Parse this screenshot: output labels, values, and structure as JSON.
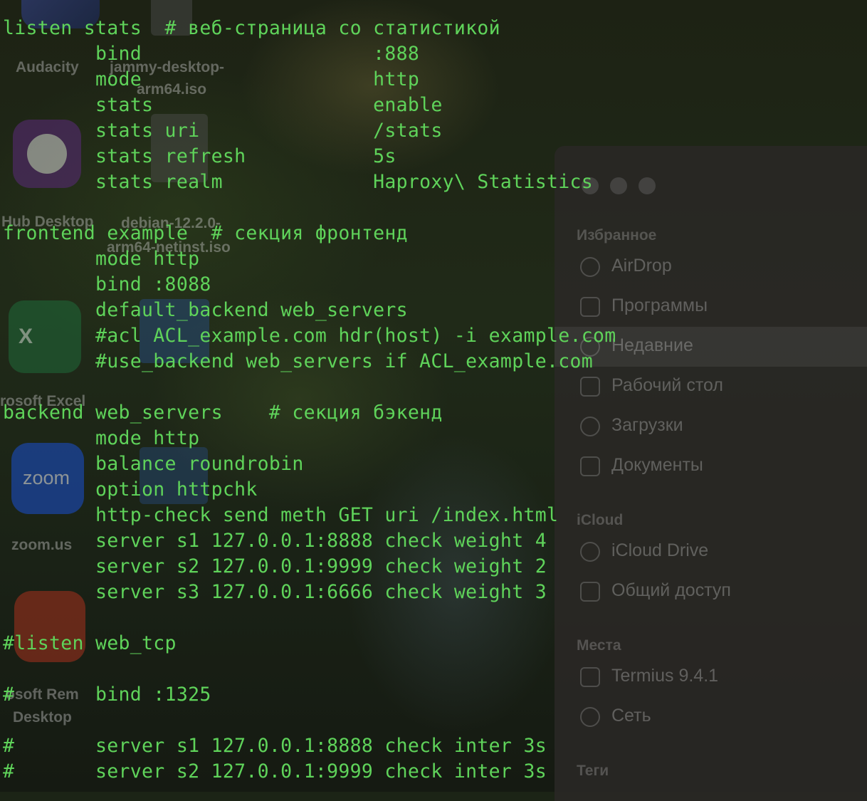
{
  "desktop": {
    "icons": [
      {
        "name": "audacity",
        "label_lines": [
          "Audacity"
        ]
      },
      {
        "name": "jammy-iso",
        "label_lines": [
          "jammy-desktop-",
          "arm64.iso"
        ]
      },
      {
        "name": "github-desktop",
        "label_lines": [
          "Hub Desktop"
        ]
      },
      {
        "name": "debian-iso",
        "label_lines": [
          "debian-12.2.0-",
          "arm64-netinst.iso"
        ]
      },
      {
        "name": "microsoft-excel",
        "label_lines": [
          "rosoft Excel"
        ]
      },
      {
        "name": "zoom",
        "label_lines": [
          "zoom.us"
        ],
        "glyph": "zoom"
      },
      {
        "name": "microsoft-remote-desktop",
        "label_lines": [
          "osoft Rem",
          "Desktop"
        ]
      }
    ]
  },
  "finder": {
    "sections": [
      {
        "title": "Избранное",
        "items": [
          {
            "label": "AirDrop",
            "icon": "airdrop-icon"
          },
          {
            "label": "Программы",
            "icon": "applications-icon"
          },
          {
            "label": "Недавние",
            "icon": "recents-icon",
            "selected": true
          },
          {
            "label": "Рабочий стол",
            "icon": "desktop-icon"
          },
          {
            "label": "Загрузки",
            "icon": "downloads-icon"
          },
          {
            "label": "Документы",
            "icon": "documents-icon"
          }
        ]
      },
      {
        "title": "iCloud",
        "items": [
          {
            "label": "iCloud Drive",
            "icon": "cloud-icon"
          },
          {
            "label": "Общий доступ",
            "icon": "shared-folder-icon"
          }
        ]
      },
      {
        "title": "Места",
        "items": [
          {
            "label": "Termius 9.4.1",
            "icon": "drive-icon"
          },
          {
            "label": "Сеть",
            "icon": "network-icon"
          }
        ]
      },
      {
        "title": "Теги",
        "items": []
      }
    ]
  },
  "terminal": {
    "text_color": "#5fd35a",
    "lines": [
      "listen stats  # веб-страница со статистикой",
      "        bind                    :888",
      "        mode                    http",
      "        stats                   enable",
      "        stats uri               /stats",
      "        stats refresh           5s",
      "        stats realm             Haproxy\\ Statistics",
      "",
      "frontend example  # секция фронтенд",
      "        mode http",
      "        bind :8088",
      "        default_backend web_servers",
      "        #acl ACL_example.com hdr(host) -i example.com",
      "        #use_backend web_servers if ACL_example.com",
      "",
      "backend web_servers    # секция бэкенд",
      "        mode http",
      "        balance roundrobin",
      "        option httpchk",
      "        http-check send meth GET uri /index.html",
      "        server s1 127.0.0.1:8888 check weight 4",
      "        server s2 127.0.0.1:9999 check weight 2",
      "        server s3 127.0.0.1:6666 check weight 3",
      "",
      "#listen web_tcp",
      "",
      "#       bind :1325",
      "",
      "#       server s1 127.0.0.1:8888 check inter 3s",
      "#       server s2 127.0.0.1:9999 check inter 3s"
    ]
  }
}
